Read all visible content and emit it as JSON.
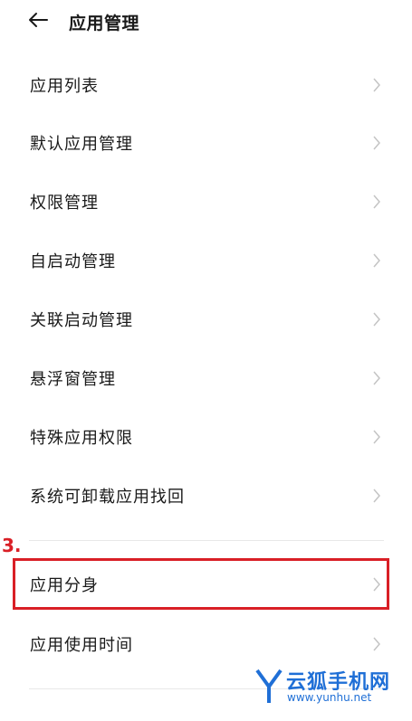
{
  "header": {
    "title": "应用管理"
  },
  "menu": {
    "items": [
      {
        "label": "应用列表"
      },
      {
        "label": "默认应用管理"
      },
      {
        "label": "权限管理"
      },
      {
        "label": "自启动管理"
      },
      {
        "label": "关联启动管理"
      },
      {
        "label": "悬浮窗管理"
      },
      {
        "label": "特殊应用权限"
      },
      {
        "label": "系统可卸载应用找回"
      },
      {
        "label": "应用分身"
      },
      {
        "label": "应用使用时间"
      }
    ]
  },
  "annotation": {
    "step": "3.",
    "color": "#d91f26"
  },
  "watermark": {
    "name": "云狐手机网",
    "url": "www.yunhu.net",
    "color": "#1f6fd6"
  }
}
